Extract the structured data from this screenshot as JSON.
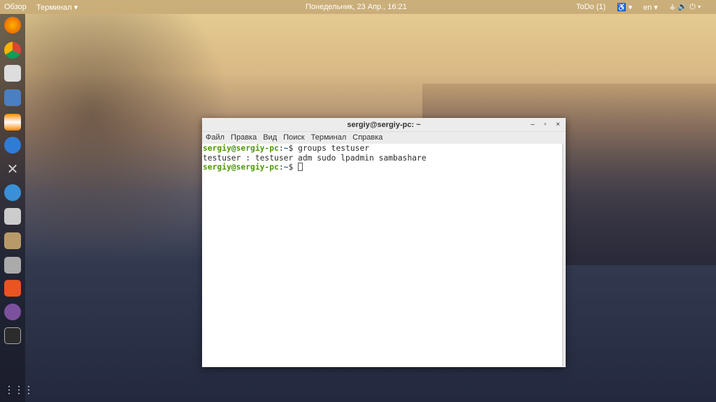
{
  "topbar": {
    "activities": "Обзор",
    "app_menu": "Терминал ▾",
    "clock": "Понедельник, 23 Апр., 16:21",
    "todo": "ToDo (1)",
    "accessibility": "♿ ▾",
    "lang": "en ▾",
    "system": "⚶ 🔊 ⏻ ▾"
  },
  "dock": {
    "items": [
      "firefox",
      "chrome",
      "rhythmbox",
      "text-editor",
      "vlc",
      "simplenote",
      "system-tools",
      "thunderbird",
      "calculator",
      "files",
      "installer",
      "software-center",
      "viber",
      "terminal"
    ],
    "apps_grid": "⋮⋮⋮"
  },
  "window": {
    "title": "sergiy@sergiy-pc: ~",
    "min": "–",
    "max": "▫",
    "close": "×",
    "menu": [
      "Файл",
      "Правка",
      "Вид",
      "Поиск",
      "Терминал",
      "Справка"
    ],
    "lines": [
      {
        "user": "sergiy@sergiy-pc",
        "sep": ":",
        "path": "~",
        "prompt": "$ ",
        "cmd": "groups testuser"
      },
      {
        "output": "testuser : testuser adm sudo lpadmin sambashare"
      },
      {
        "user": "sergiy@sergiy-pc",
        "sep": ":",
        "path": "~",
        "prompt": "$ "
      }
    ]
  }
}
